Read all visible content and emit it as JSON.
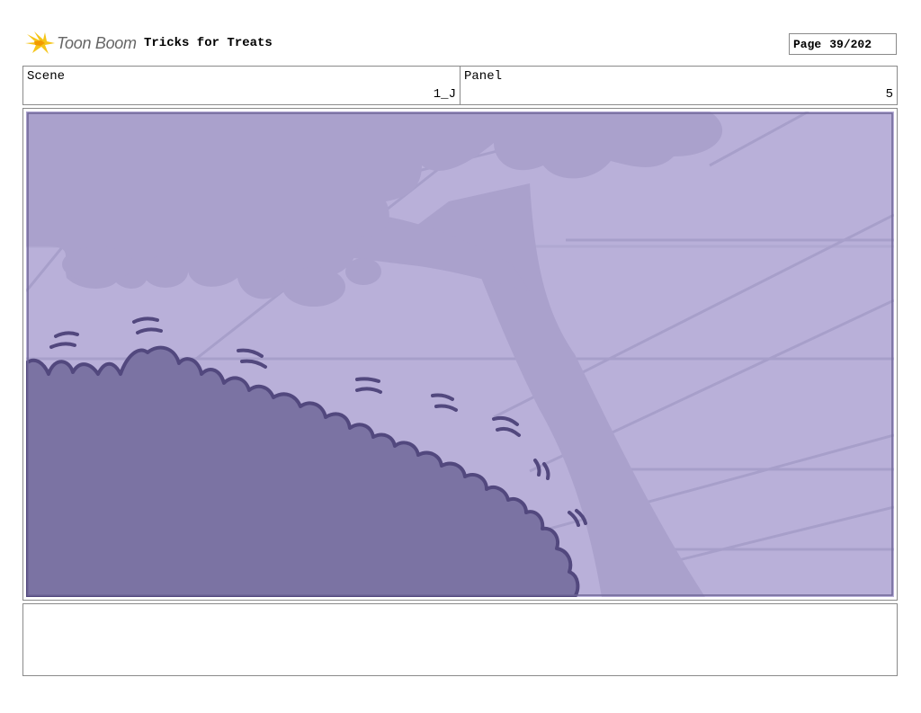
{
  "header": {
    "logo_text": "Toon Boom",
    "project_title": "Tricks for Treats",
    "page_label": "Page",
    "page_value": "39/202"
  },
  "scene": {
    "label": "Scene",
    "value": "1_J"
  },
  "panel": {
    "label": "Panel",
    "value": "5"
  },
  "colors": {
    "sky": "#b9b0d9",
    "tree": "#aaa1cc",
    "bush": "#7b73a3",
    "bush_outline": "#52487e",
    "logo_yellow": "#f5c518"
  },
  "notes": ""
}
